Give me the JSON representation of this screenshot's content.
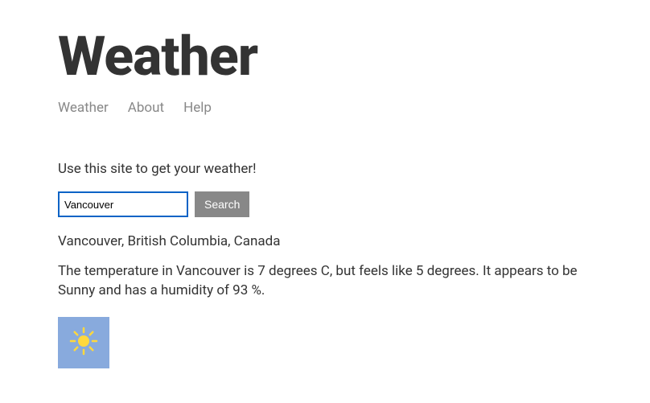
{
  "header": {
    "title": "Weather"
  },
  "nav": {
    "items": [
      "Weather",
      "About",
      "Help"
    ]
  },
  "intro": "Use this site to get your weather!",
  "search": {
    "value": "Vancouver",
    "button_label": "Search"
  },
  "result": {
    "location": "Vancouver, British Columbia, Canada",
    "description": "The temperature in Vancouver is 7 degrees C, but feels like 5 degrees. It appears to be Sunny and has a humidity of 93 %.",
    "icon": "sun-icon"
  }
}
